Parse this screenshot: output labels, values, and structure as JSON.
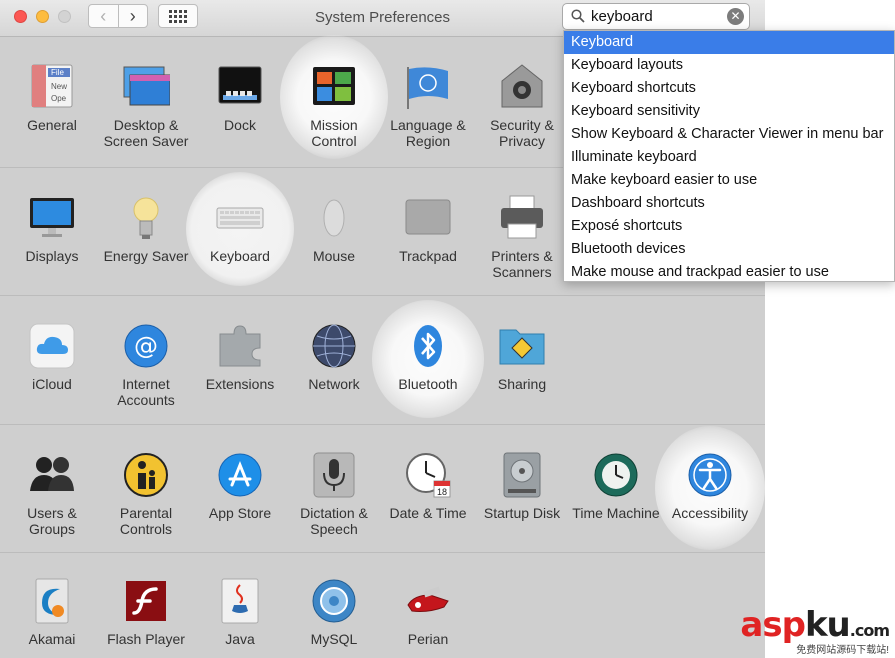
{
  "window": {
    "title": "System Preferences"
  },
  "search": {
    "value": "keyboard"
  },
  "dropdown": [
    "Keyboard",
    "Keyboard layouts",
    "Keyboard shortcuts",
    "Keyboard sensitivity",
    "Show Keyboard & Character Viewer in menu bar",
    "Illuminate keyboard",
    "Make keyboard easier to use",
    "Dashboard shortcuts",
    "Exposé shortcuts",
    "Bluetooth devices",
    "Make mouse and trackpad easier to use"
  ],
  "rows": [
    {
      "items": [
        {
          "label": "General",
          "icon": "general-icon"
        },
        {
          "label": "Desktop & Screen Saver",
          "icon": "desktop-icon"
        },
        {
          "label": "Dock",
          "icon": "dock-icon"
        },
        {
          "label": "Mission Control",
          "icon": "mission-control-icon"
        },
        {
          "label": "Language & Region",
          "icon": "language-region-icon"
        },
        {
          "label": "Security & Privacy",
          "icon": "security-icon"
        }
      ]
    },
    {
      "items": [
        {
          "label": "Displays",
          "icon": "displays-icon"
        },
        {
          "label": "Energy Saver",
          "icon": "energy-saver-icon"
        },
        {
          "label": "Keyboard",
          "icon": "keyboard-icon"
        },
        {
          "label": "Mouse",
          "icon": "mouse-icon"
        },
        {
          "label": "Trackpad",
          "icon": "trackpad-icon"
        },
        {
          "label": "Printers & Scanners",
          "icon": "printer-icon"
        }
      ]
    },
    {
      "items": [
        {
          "label": "iCloud",
          "icon": "icloud-icon"
        },
        {
          "label": "Internet Accounts",
          "icon": "internet-accounts-icon"
        },
        {
          "label": "Extensions",
          "icon": "extensions-icon"
        },
        {
          "label": "Network",
          "icon": "network-icon"
        },
        {
          "label": "Bluetooth",
          "icon": "bluetooth-icon"
        },
        {
          "label": "Sharing",
          "icon": "sharing-icon"
        }
      ]
    },
    {
      "items": [
        {
          "label": "Users & Groups",
          "icon": "users-icon"
        },
        {
          "label": "Parental Controls",
          "icon": "parental-controls-icon"
        },
        {
          "label": "App Store",
          "icon": "app-store-icon"
        },
        {
          "label": "Dictation & Speech",
          "icon": "microphone-icon"
        },
        {
          "label": "Date & Time",
          "icon": "clock-icon"
        },
        {
          "label": "Startup Disk",
          "icon": "disk-icon"
        },
        {
          "label": "Time Machine",
          "icon": "time-machine-icon"
        },
        {
          "label": "Accessibility",
          "icon": "accessibility-icon"
        }
      ]
    },
    {
      "items": [
        {
          "label": "Akamai",
          "icon": "akamai-icon"
        },
        {
          "label": "Flash Player",
          "icon": "flash-icon"
        },
        {
          "label": "Java",
          "icon": "java-icon"
        },
        {
          "label": "MySQL",
          "icon": "mysql-icon"
        },
        {
          "label": "Perian",
          "icon": "perian-icon"
        }
      ]
    }
  ],
  "icon_text": {
    "general_file": "File",
    "general_new": "New",
    "general_open": "Ope",
    "calendar_day": "18"
  },
  "watermark": {
    "brand_a": "asp",
    "brand_k": "ku",
    "brand_com": ".com",
    "tagline": "免费网站源码下载站!"
  }
}
